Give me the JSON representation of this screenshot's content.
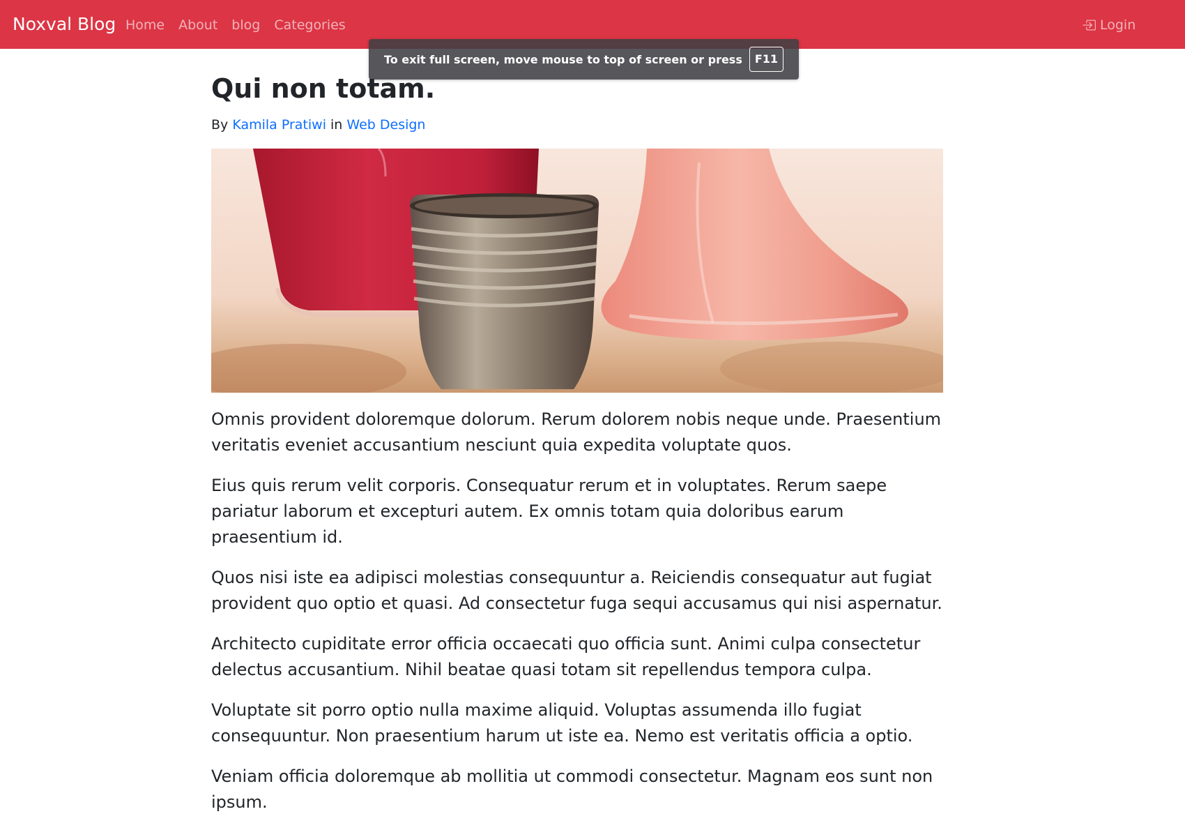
{
  "navbar": {
    "brand": "Noxval Blog",
    "links": [
      "Home",
      "About",
      "blog",
      "Categories"
    ],
    "login_label": "Login",
    "login_icon": "box-arrow-in-right-icon",
    "background_color": "#dc3545"
  },
  "fullscreen_notice": {
    "message": "To exit full screen, move mouse to top of screen or press",
    "key": "F11"
  },
  "article": {
    "title": "Qui non totam.",
    "meta": {
      "by_label": "By",
      "author": "Kamila Pratiwi",
      "in_label": "in",
      "category": "Web Design"
    },
    "paragraphs": [
      "Omnis provident doloremque dolorum. Rerum dolorem nobis neque unde. Praesentium veritatis eveniet accusantium nesciunt quia expedita voluptate quos.",
      "Eius quis rerum velit corporis. Consequatur rerum et in voluptates. Rerum saepe pariatur laborum et excepturi autem. Ex omnis totam quia doloribus earum praesentium id.",
      "Quos nisi iste ea adipisci molestias consequuntur a. Reiciendis consequatur aut fugiat provident quo optio et quasi. Ad consectetur fuga sequi accusamus qui nisi aspernatur.",
      "Architecto cupiditate error officia occaecati quo officia sunt. Animi culpa consectetur delectus accusantium. Nihil beatae quasi totam sit repellendus tempora culpa.",
      "Voluptate sit porro optio nulla maxime aliquid. Voluptas assumenda illo fugiat consequuntur. Non praesentium harum ut iste ea. Nemo est veritatis officia a optio.",
      "Veniam officia doloremque ab mollitia ut commodi consectetur. Magnam eos sunt non ipsum."
    ]
  },
  "colors": {
    "link": "#0d6efd",
    "text": "#212529"
  }
}
